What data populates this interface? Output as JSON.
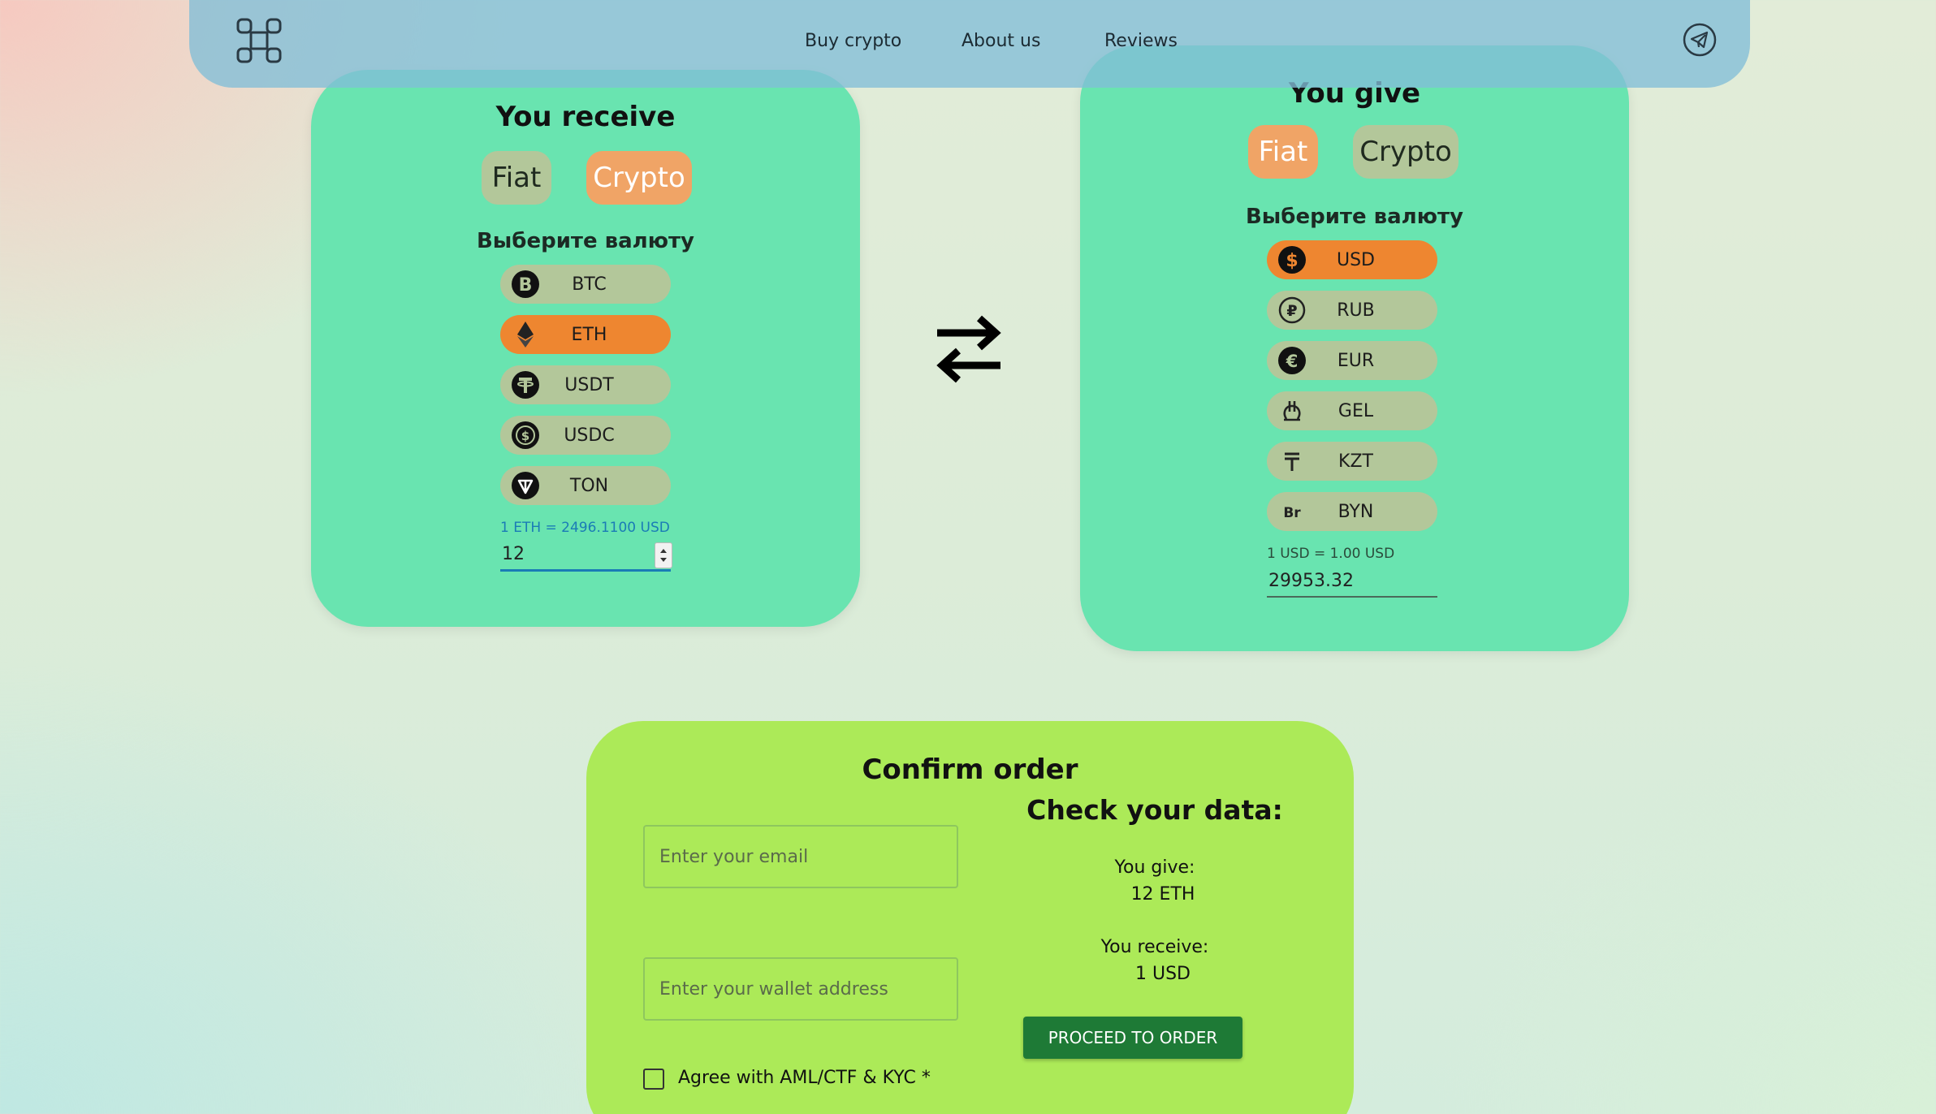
{
  "nav": {
    "links": [
      "Buy crypto",
      "About us",
      "Reviews"
    ],
    "logo_icon": "logo-icon",
    "telegram_icon": "telegram-icon"
  },
  "receive": {
    "title": "You receive",
    "fiat_label": "Fiat",
    "crypto_label": "Crypto",
    "selected_tab": "Crypto",
    "select_label": "Выберите валюту",
    "currencies": [
      {
        "code": "BTC",
        "icon": "bitcoin-icon",
        "active": false
      },
      {
        "code": "ETH",
        "icon": "ethereum-icon",
        "active": true
      },
      {
        "code": "USDT",
        "icon": "tether-icon",
        "active": false
      },
      {
        "code": "USDC",
        "icon": "usdc-icon",
        "active": false
      },
      {
        "code": "TON",
        "icon": "ton-icon",
        "active": false
      }
    ],
    "rate": "1 ETH = 2496.1100 USD",
    "amount": "12"
  },
  "give": {
    "title": "You give",
    "fiat_label": "Fiat",
    "crypto_label": "Crypto",
    "selected_tab": "Fiat",
    "select_label": "Выберите валюту",
    "currencies": [
      {
        "code": "USD",
        "icon": "dollar-icon",
        "active": true
      },
      {
        "code": "RUB",
        "icon": "ruble-icon",
        "active": false
      },
      {
        "code": "EUR",
        "icon": "euro-icon",
        "active": false
      },
      {
        "code": "GEL",
        "icon": "lari-icon",
        "active": false
      },
      {
        "code": "KZT",
        "icon": "tenge-icon",
        "active": false
      },
      {
        "code": "BYN",
        "icon": "belarus-ruble-icon",
        "active": false
      }
    ],
    "rate": "1 USD = 1.00 USD",
    "amount": "29953.32"
  },
  "confirm": {
    "title": "Confirm order",
    "check_title": "Check your data:",
    "email_placeholder": "Enter your email",
    "wallet_placeholder": "Enter your wallet address",
    "give_label": "You give:",
    "give_value": "12 ETH",
    "receive_label": "You receive:",
    "receive_value": "1 USD",
    "proceed_label": "PROCEED TO ORDER",
    "agree_label": "Agree with AML/CTF & KYC *"
  },
  "colors": {
    "card_teal": "#69e4b0",
    "card_green": "#acea58",
    "active_orange": "#ee8630",
    "chip": "#b3c79a",
    "header": "#82bed7",
    "button": "#1e7a36"
  }
}
